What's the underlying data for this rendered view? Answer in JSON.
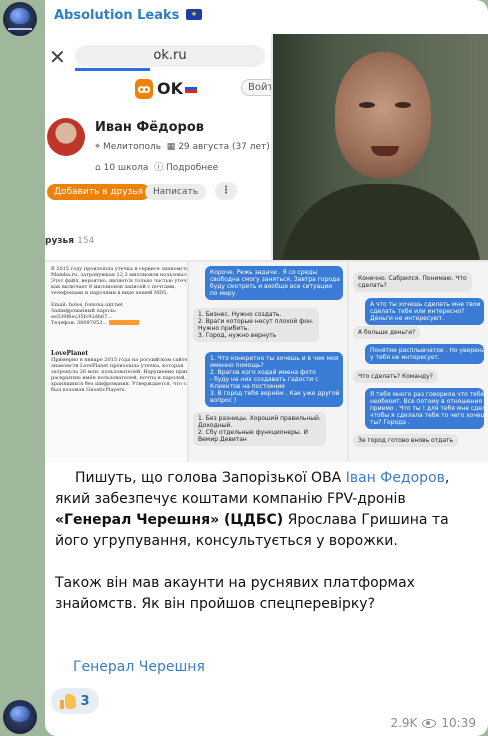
{
  "channel": {
    "name": "Absolution Leaks",
    "flag_icon": "eu-flag-icon"
  },
  "ok_screenshot": {
    "close_glyph": "✕",
    "url": "ok.ru",
    "brand": "OK",
    "login_button": "Войти",
    "profile_name": "Иван Фёдоров",
    "location": "Мелитополь",
    "birthday": "29 августа (37 лет)",
    "school": "10 школа",
    "details_link": "Подробнее",
    "add_friend_button": "Добавить в друзья",
    "write_button": "Написать",
    "more_button": "⋮",
    "friends_label": "рузья",
    "friends_count": "154"
  },
  "leak_doc": {
    "lines": [
      "В 2015 году произошла утечка в сервисе знакомств",
      "Mamba.ru, затронувшая 12,3 миллионов пользователей.",
      "Этот файл, вероятно, является только частью утечки, так",
      "как включает 8 миллионов записей с почтами,",
      "телефонами и паролями в виде хешей MD5."
    ],
    "email": "Email: holos_fomona.ukr.net",
    "password": "Зашифрованный пароль:",
    "hash": "ee539f6ec35fc92db67...",
    "phone": "Телефон: 38097853...",
    "lovep": "LovePlanet",
    "lovep_lines": [
      "Примерно в январе 2015 года на российском сайте",
      "знакомств LovePlanet произошла утечка, которая",
      "затронула 26 млн. пользователей. Нарушение привело к",
      "раскрытию имён пользователей, почты и паролей,",
      "хранящихся без шифрования. Утверждается, что сайт",
      "был взломан GnosticPlayers."
    ]
  },
  "chat_a": [
    {
      "dir": "out",
      "text": "Короче. Режь задачи . Я со среды\nсвободна смогу заняться. Завтра города\nбуду смотреть и вообще все ситуации\nпо миру."
    },
    {
      "dir": "in",
      "text": "1. Бизнес. Нужно создать.\n2. Враги которые несут плохой фон.\nНужно прибить.\n3. Город, нужно вернуть"
    },
    {
      "dir": "out",
      "text": "1. Что конкретно ты хочешь и в чем моя\nименно помощь?\n2. Врагов кого ходай имена фото\n- буду на них создавать гадости с\nКлиентов на постоение\n3. В город тебя вернём . Как уже другой\nвопрос )"
    },
    {
      "dir": "in",
      "text": "1. Без разницы. Хороший правильный.\nДоходный.\n2. Сбу отдельные функционеры. И\nВемир Девитан"
    }
  ],
  "chat_b": [
    {
      "dir": "in",
      "text": "Конечно. Сабрился. Понимаю. Что\nсделать?"
    },
    {
      "dir": "out",
      "text": "А что ты хочешь сделать мне твои\nсделать тебе или интересно?\nДеньги не интересуют."
    },
    {
      "dir": "in",
      "text": "А больше деньги?"
    },
    {
      "dir": "out",
      "text": "Понятие расплывчатое . Но уверена что\nу тебя не интересует."
    },
    {
      "dir": "in",
      "text": "Что сделать? Команду?"
    },
    {
      "dir": "out",
      "text": "Я тебя много раз говорила что тебе\nнеобхоит. Все потому в отношения\nприемо . Что ты ! для тебя мне сделать\nчтобы я сделала тебе то чего хочешь\nты? Города ."
    },
    {
      "dir": "in",
      "text": "Зе город готово вновь отдать"
    }
  ],
  "post": {
    "p1_prefix": "Пишуть, що голова Запорізької ОВА ",
    "p1_link": "Іван Федоров",
    "p1_mid": ", який забезпечує коштами компанію FPV-дронів ",
    "p1_bold": "«Генерал Черешня» (ЦДБС)",
    "p1_suffix": " Ярослава Гришина та його угрупування, консультується у ворожки.",
    "p2": "Також він мав акаунти на руснявих платформах знайомств. Як він пройшов спецперевірку?"
  },
  "tag_link": "Генерал Черешня",
  "reaction": {
    "icon": "thumbs-up-icon",
    "count": "3"
  },
  "footer": {
    "views": "2.9K",
    "time": "10:39"
  }
}
